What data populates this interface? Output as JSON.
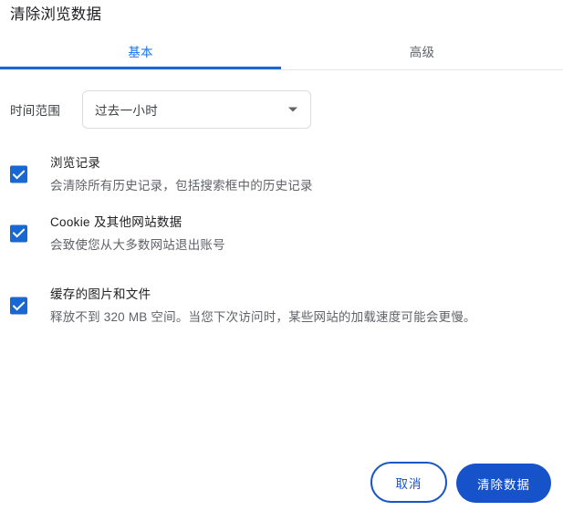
{
  "dialog": {
    "title": "清除浏览数据"
  },
  "tabs": [
    {
      "id": "basic",
      "label": "基本",
      "active": true
    },
    {
      "id": "advanced",
      "label": "高级",
      "active": false
    }
  ],
  "time_range": {
    "label": "时间范围",
    "value": "过去一小时",
    "arrow_icon": "chevron-down-icon"
  },
  "options": [
    {
      "id": "browsing-history",
      "title": "浏览记录",
      "description": "会清除所有历史记录，包括搜索框中的历史记录",
      "checked": true
    },
    {
      "id": "cookies",
      "title": "Cookie 及其他网站数据",
      "description": "会致使您从大多数网站退出账号",
      "checked": true
    },
    {
      "id": "cached-images",
      "title": "缓存的图片和文件",
      "description": "释放不到 320 MB 空间。当您下次访问时，某些网站的加载速度可能会更慢。",
      "checked": true
    }
  ],
  "footer": {
    "cancel_label": "取消",
    "clear_label": "清除数据"
  },
  "colors": {
    "accent_blue": "#1a73e8",
    "tab_indicator": "#1967d2",
    "checkbox_blue": "#1967d2",
    "primary_button": "#1652ca",
    "cancel_border": "#1a56c4",
    "title_text": "#202124",
    "secondary_text": "#5f6368",
    "border_gray": "#dadce0"
  }
}
